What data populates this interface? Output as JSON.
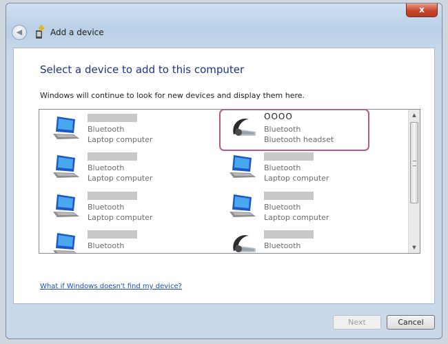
{
  "window": {
    "title": "Add a device",
    "close_symbol": "x",
    "back_symbol": "◀"
  },
  "main": {
    "heading": "Select a device to add to this computer",
    "description": "Windows will continue to look for new devices and display them here."
  },
  "devices": [
    {
      "name": "",
      "line1": "Bluetooth",
      "line2": "Laptop computer",
      "icon": "laptop-icon"
    },
    {
      "name": "OOOO",
      "line1": "Bluetooth",
      "line2": "Bluetooth headset",
      "icon": "headset-icon"
    },
    {
      "name": "",
      "line1": "Bluetooth",
      "line2": "Laptop computer",
      "icon": "laptop-icon"
    },
    {
      "name": "",
      "line1": "Bluetooth",
      "line2": "Laptop computer",
      "icon": "laptop-icon"
    },
    {
      "name": "",
      "line1": "Bluetooth",
      "line2": "Laptop computer",
      "icon": "laptop-icon"
    },
    {
      "name": "",
      "line1": "Bluetooth",
      "line2": "Laptop computer",
      "icon": "laptop-icon"
    },
    {
      "name": "",
      "line1": "Bluetooth",
      "line2": "",
      "icon": "laptop-icon"
    },
    {
      "name": "",
      "line1": "Bluetooth",
      "line2": "",
      "icon": "headset-icon"
    }
  ],
  "scrollbar": {
    "up_symbol": "▲",
    "down_symbol": "▼"
  },
  "help_link": "What if Windows doesn't find my device?",
  "buttons": {
    "next": "Next",
    "cancel": "Cancel"
  },
  "colors": {
    "heading": "#1e3287",
    "link": "#1a4ac2",
    "highlight": "#b65a86"
  }
}
